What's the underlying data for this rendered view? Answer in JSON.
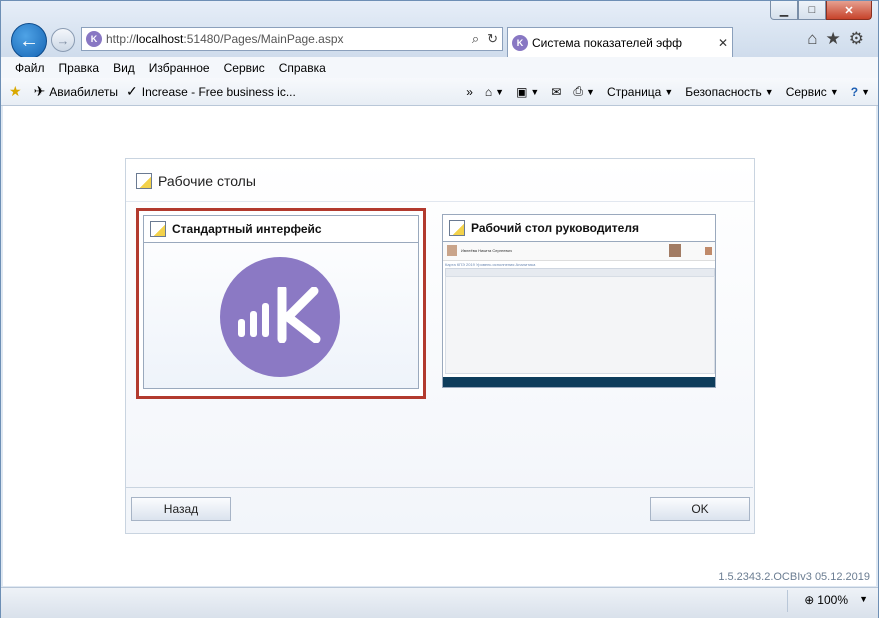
{
  "browser": {
    "url": "http://localhost:51480/Pages/MainPage.aspx",
    "url_host": "localhost",
    "url_prefix": "http://",
    "url_suffix": ":51480/Pages/MainPage.aspx",
    "tab_title": "Система показателей эфф",
    "tab_close": "✕"
  },
  "menu": [
    "Файл",
    "Правка",
    "Вид",
    "Избранное",
    "Сервис",
    "Справка"
  ],
  "favorites": [
    {
      "icon": "plane-icon",
      "label": "Авиабилеты"
    },
    {
      "icon": "checkmark-icon",
      "label": "Increase - Free business ic..."
    }
  ],
  "commandbar": {
    "page": "Страница",
    "safety": "Безопасность",
    "tools": "Сервис"
  },
  "dialog": {
    "title": "Рабочие столы",
    "cards": [
      {
        "title": "Стандартный интерфейс",
        "selected": true
      },
      {
        "title": "Рабочий стол руководителя",
        "selected": false
      }
    ],
    "back_label": "Назад",
    "ok_label": "OK",
    "accent_color": "#b23a2e",
    "logo_color": "#8b79c4"
  },
  "preview": {
    "name_text": "Ивлеёва Никита Сергеевич",
    "subtabs_text": "Карта КПЭ 2019  Уровень исполнения  Аналитика"
  },
  "version": "1.5.2343.2.OCBIv3  05.12.2019",
  "status": {
    "zoom": "100%"
  }
}
